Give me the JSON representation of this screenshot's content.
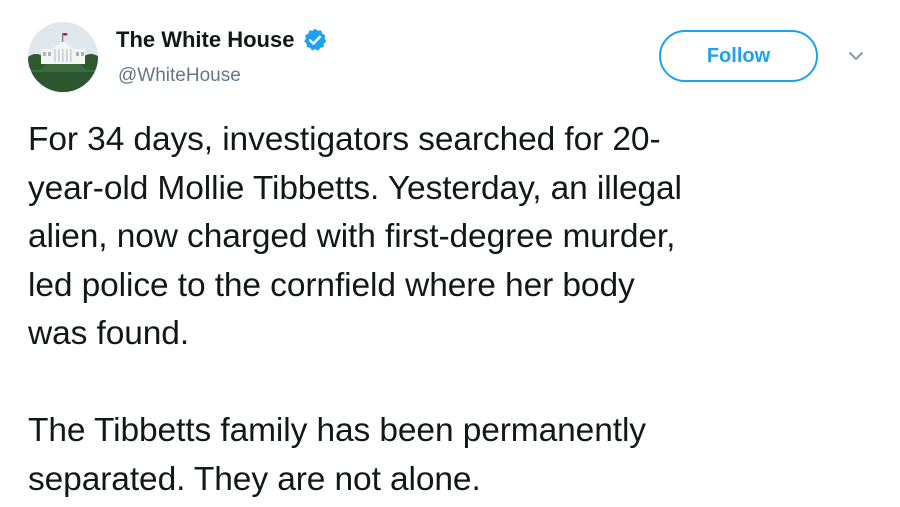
{
  "account": {
    "display_name": "The White House",
    "handle": "@WhiteHouse",
    "verified": true,
    "avatar_icon": "white-house-building-icon",
    "verified_icon": "verified-badge-icon"
  },
  "actions": {
    "follow_label": "Follow",
    "menu_icon": "chevron-down-icon"
  },
  "tweet": {
    "paragraphs": [
      "For 34 days, investigators searched for 20-\nyear-old Mollie Tibbetts. Yesterday, an illegal\nalien, now charged with first-degree murder,\nled police to the cornfield where her body\nwas found.",
      "The Tibbetts family has been permanently\nseparated. They are not alone."
    ]
  },
  "colors": {
    "accent": "#1da1f2",
    "text": "#14171a",
    "secondary_text": "#657786"
  }
}
